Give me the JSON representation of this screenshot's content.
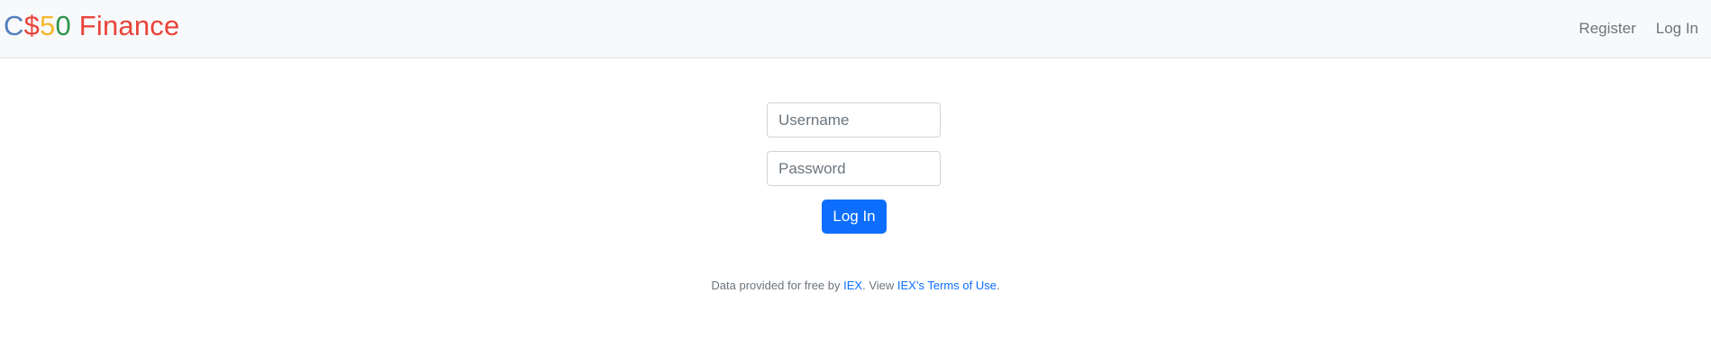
{
  "brand": {
    "letters": [
      "C",
      "$",
      "5",
      "0"
    ],
    "rest": " Finance",
    "colors": {
      "C": "#537fbe",
      "$": "#ea433b",
      "5": "#f5b82e",
      "0": "#2e944b",
      "Finance": "#ea433b"
    }
  },
  "nav": {
    "register_label": "Register",
    "login_label": "Log In"
  },
  "form": {
    "username_placeholder": "Username",
    "password_placeholder": "Password",
    "submit_label": "Log In"
  },
  "footer": {
    "prefix": "Data provided for free by ",
    "iex_link": "IEX",
    "middle": ". View ",
    "terms_link": "IEX’s Terms of Use",
    "suffix": "."
  },
  "theme": {
    "primary": "#0d6efd",
    "navbar_bg": "#f8f9fa",
    "muted_text": "#6c757d"
  }
}
